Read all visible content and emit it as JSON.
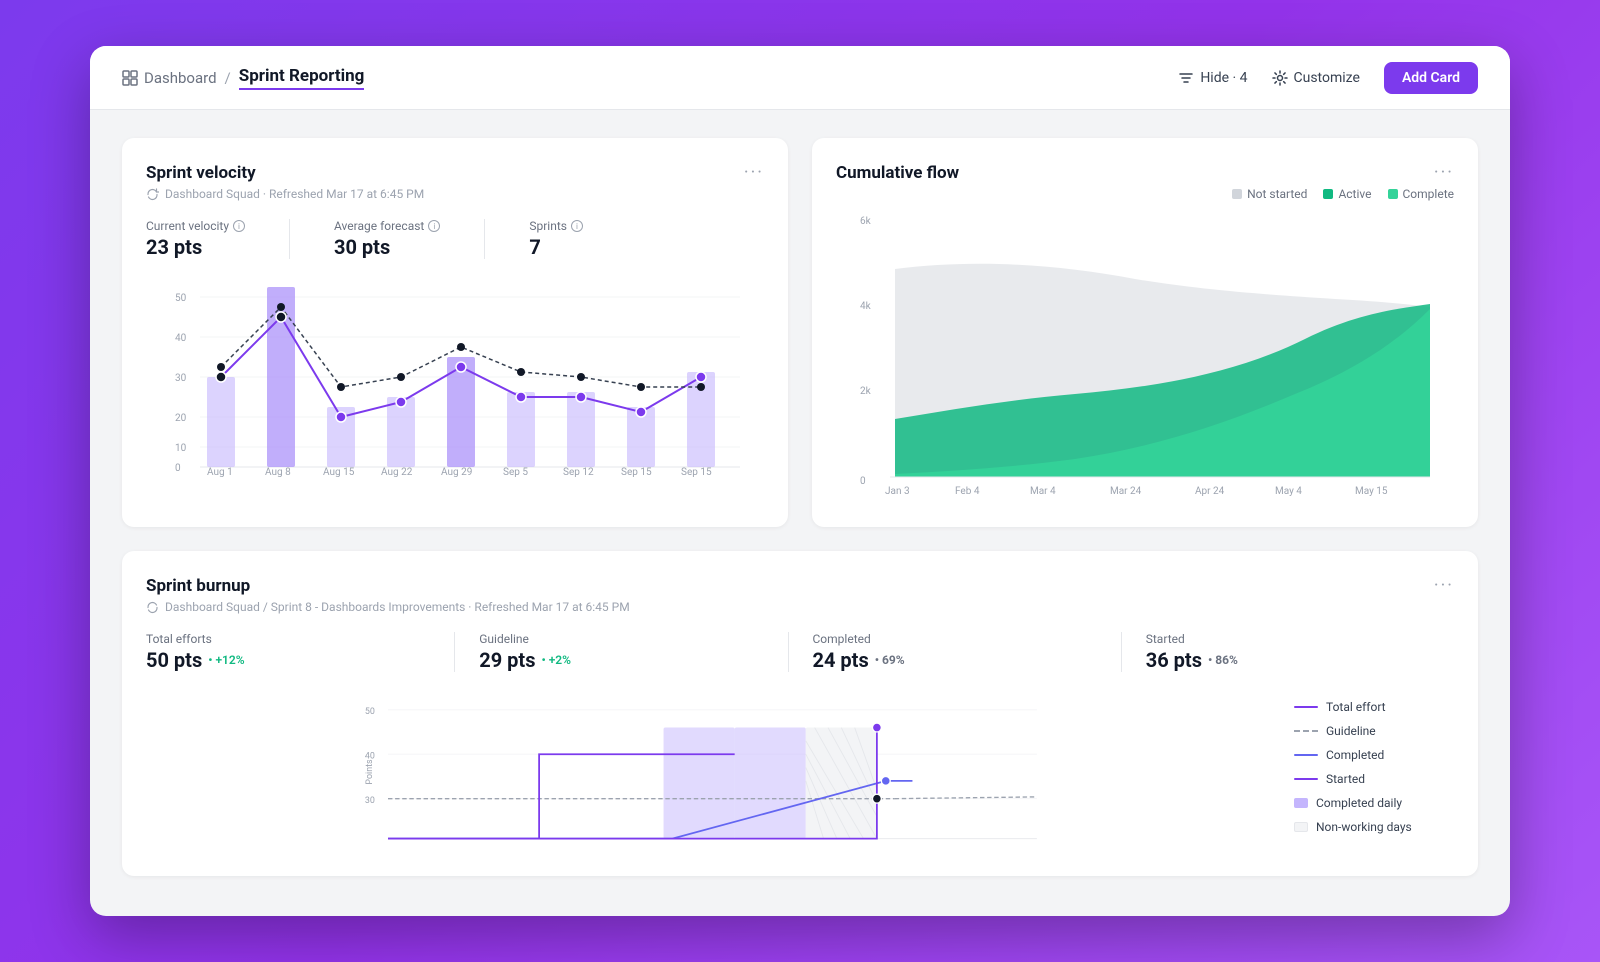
{
  "header": {
    "dashboard_label": "Dashboard",
    "separator": "/",
    "current_page": "Sprint Reporting",
    "hide_label": "Hide · 4",
    "customize_label": "Customize",
    "add_card_label": "Add Card"
  },
  "velocity_card": {
    "title": "Sprint velocity",
    "subtitle": "Dashboard Squad · Refreshed Mar 17 at 6:45 PM",
    "menu": "···",
    "current_velocity_label": "Current velocity",
    "current_velocity_value": "23 pts",
    "avg_forecast_label": "Average forecast",
    "avg_forecast_value": "30 pts",
    "sprints_label": "Sprints",
    "sprints_value": "7"
  },
  "cumulative_card": {
    "title": "Cumulative flow",
    "menu": "···",
    "legend": [
      {
        "label": "Not started",
        "color": "#d1d5db"
      },
      {
        "label": "Active",
        "color": "#10b981"
      },
      {
        "label": "Complete",
        "color": "#34d399"
      }
    ],
    "y_axis": [
      "6k",
      "4k",
      "2k",
      "0"
    ],
    "x_axis": [
      "Jan 3",
      "Feb 4",
      "Mar 4",
      "Mar 24",
      "Apr 24",
      "May 4",
      "May 15"
    ]
  },
  "burnup_card": {
    "title": "Sprint burnup",
    "subtitle": "Dashboard Squad / Sprint 8 - Dashboards Improvements · Refreshed Mar 17 at 6:45 PM",
    "menu": "···",
    "stats": [
      {
        "label": "Total efforts",
        "value": "50 pts",
        "badge": "+12%",
        "badge_type": "green"
      },
      {
        "label": "Guideline",
        "value": "29 pts",
        "badge": "+2%",
        "badge_type": "green"
      },
      {
        "label": "Completed",
        "value": "24 pts",
        "badge": "69%",
        "badge_type": "gray"
      },
      {
        "label": "Started",
        "value": "36 pts",
        "badge": "86%",
        "badge_type": "gray"
      }
    ],
    "legend": [
      {
        "label": "Total effort",
        "type": "solid",
        "color": "#7c3aed"
      },
      {
        "label": "Guideline",
        "type": "dashed",
        "color": "#9ca3af"
      },
      {
        "label": "Completed",
        "type": "solid",
        "color": "#6366f1"
      },
      {
        "label": "Started",
        "type": "solid",
        "color": "#7c3aed"
      },
      {
        "label": "Completed daily",
        "type": "box",
        "color": "#c4b5fd"
      },
      {
        "label": "Non-working days",
        "type": "box",
        "color": "#f3f4f6"
      }
    ],
    "y_axis": [
      "50",
      "40",
      "30"
    ],
    "x_label": "Points"
  },
  "colors": {
    "purple": "#7c3aed",
    "light_purple": "#8b5cf6",
    "bar_purple": "#a78bfa",
    "bar_light": "#c4b5fd",
    "teal": "#10b981",
    "light_teal": "#34d399",
    "gray_bar": "#d1d5db",
    "accent": "#7c3aed"
  }
}
